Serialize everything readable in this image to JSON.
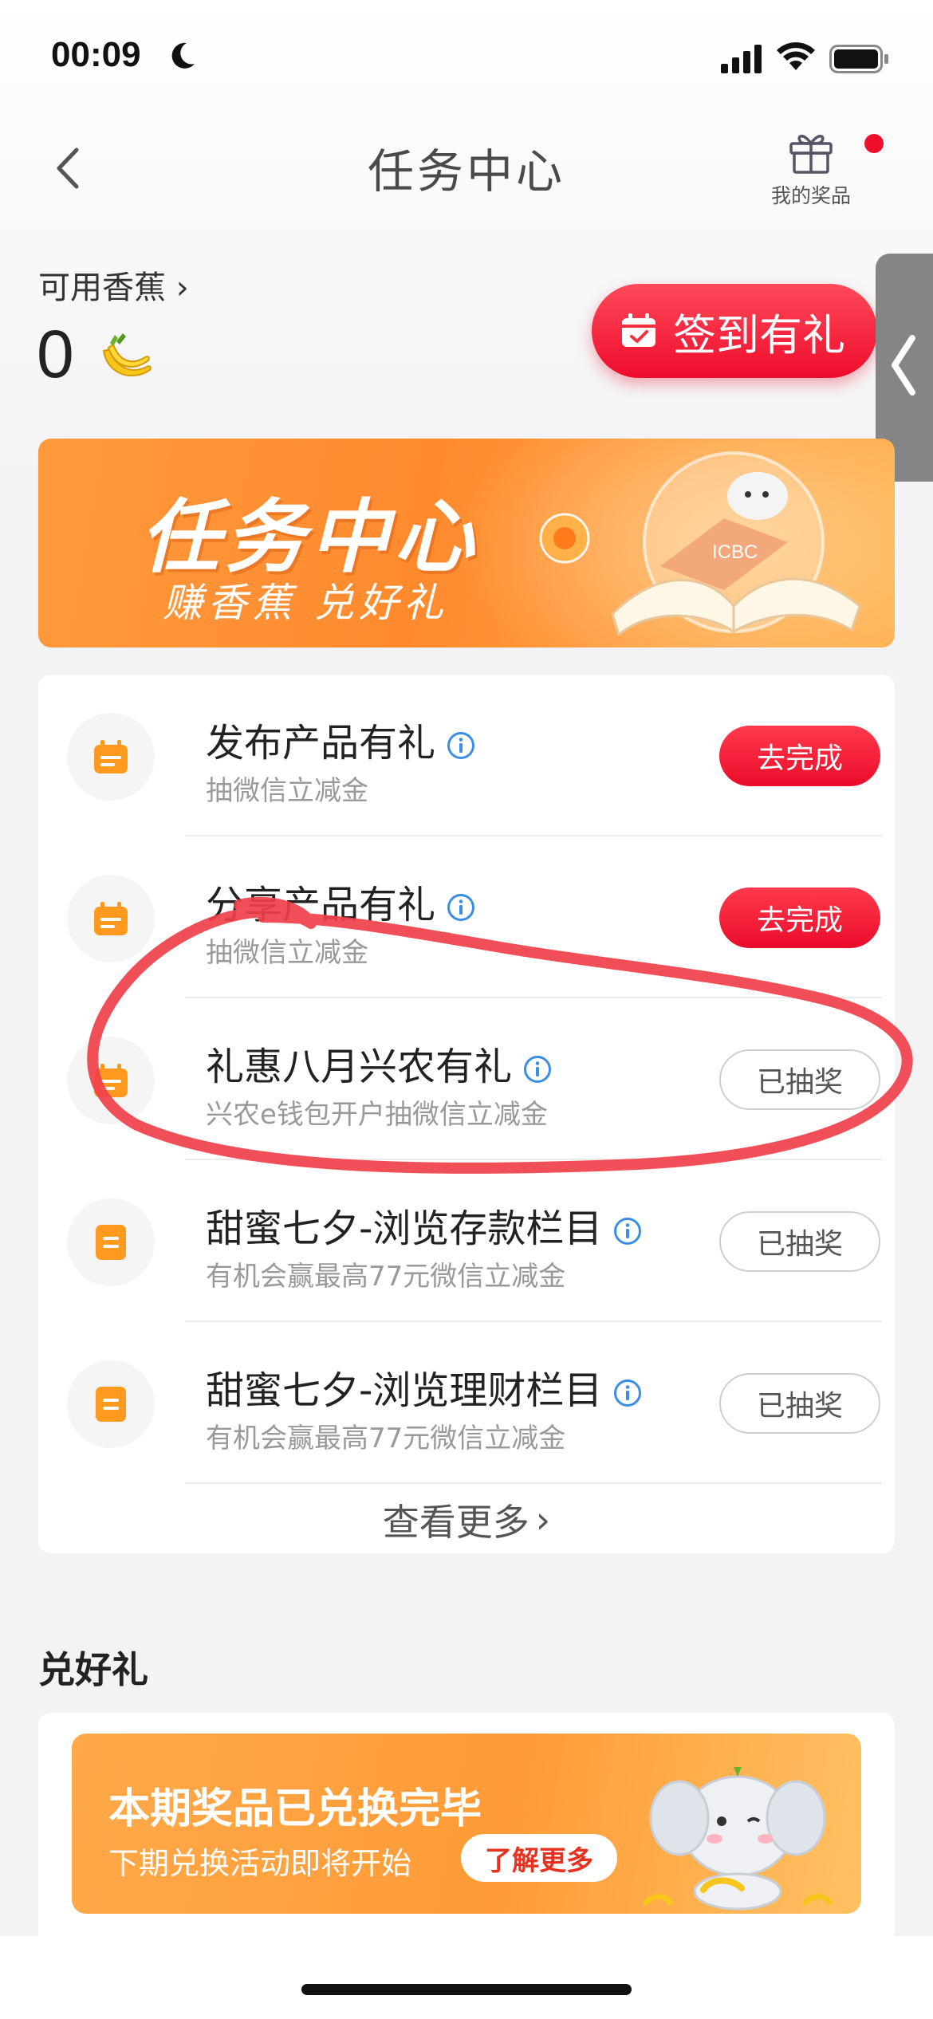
{
  "status_bar": {
    "time": "00:09"
  },
  "nav": {
    "title": "任务中心",
    "prizes_label": "我的奖品"
  },
  "bananas": {
    "label": "可用香蕉",
    "chevron": "›",
    "count": "0"
  },
  "checkin": {
    "label": "签到有礼"
  },
  "banner": {
    "title": "任务中心",
    "subtitle": "赚香蕉 兑好礼",
    "logo_text": "ICBC"
  },
  "tasks": [
    {
      "title": "发布产品有礼",
      "subtitle": "抽微信立减金",
      "button": "去完成",
      "state": "todo"
    },
    {
      "title": "分享产品有礼",
      "subtitle": "抽微信立减金",
      "button": "去完成",
      "state": "todo"
    },
    {
      "title": "礼惠八月兴农有礼",
      "subtitle": "兴农e钱包开户抽微信立减金",
      "button": "已抽奖",
      "state": "done"
    },
    {
      "title": "甜蜜七夕-浏览存款栏目",
      "subtitle": "有机会赢最高77元微信立减金",
      "button": "已抽奖",
      "state": "done"
    },
    {
      "title": "甜蜜七夕-浏览理财栏目",
      "subtitle": "有机会赢最高77元微信立减金",
      "button": "已抽奖",
      "state": "done"
    }
  ],
  "view_more": {
    "label": "查看更多",
    "chevron": "›"
  },
  "gifts": {
    "section_title": "兑好礼",
    "banner_title": "本期奖品已兑换完毕",
    "banner_subtitle": "下期兑换活动即将开始",
    "learn_more": "了解更多"
  },
  "colors": {
    "accent_red": "#ee0c2b",
    "orange": "#ff8a2e",
    "annotation": "#f0404a"
  },
  "icons": [
    "moon-icon",
    "signal-icon",
    "wifi-icon",
    "battery-icon",
    "back-icon",
    "gift-icon",
    "banana-icon",
    "calendar-icon",
    "side-collapse-icon",
    "info-icon",
    "document-icon"
  ]
}
